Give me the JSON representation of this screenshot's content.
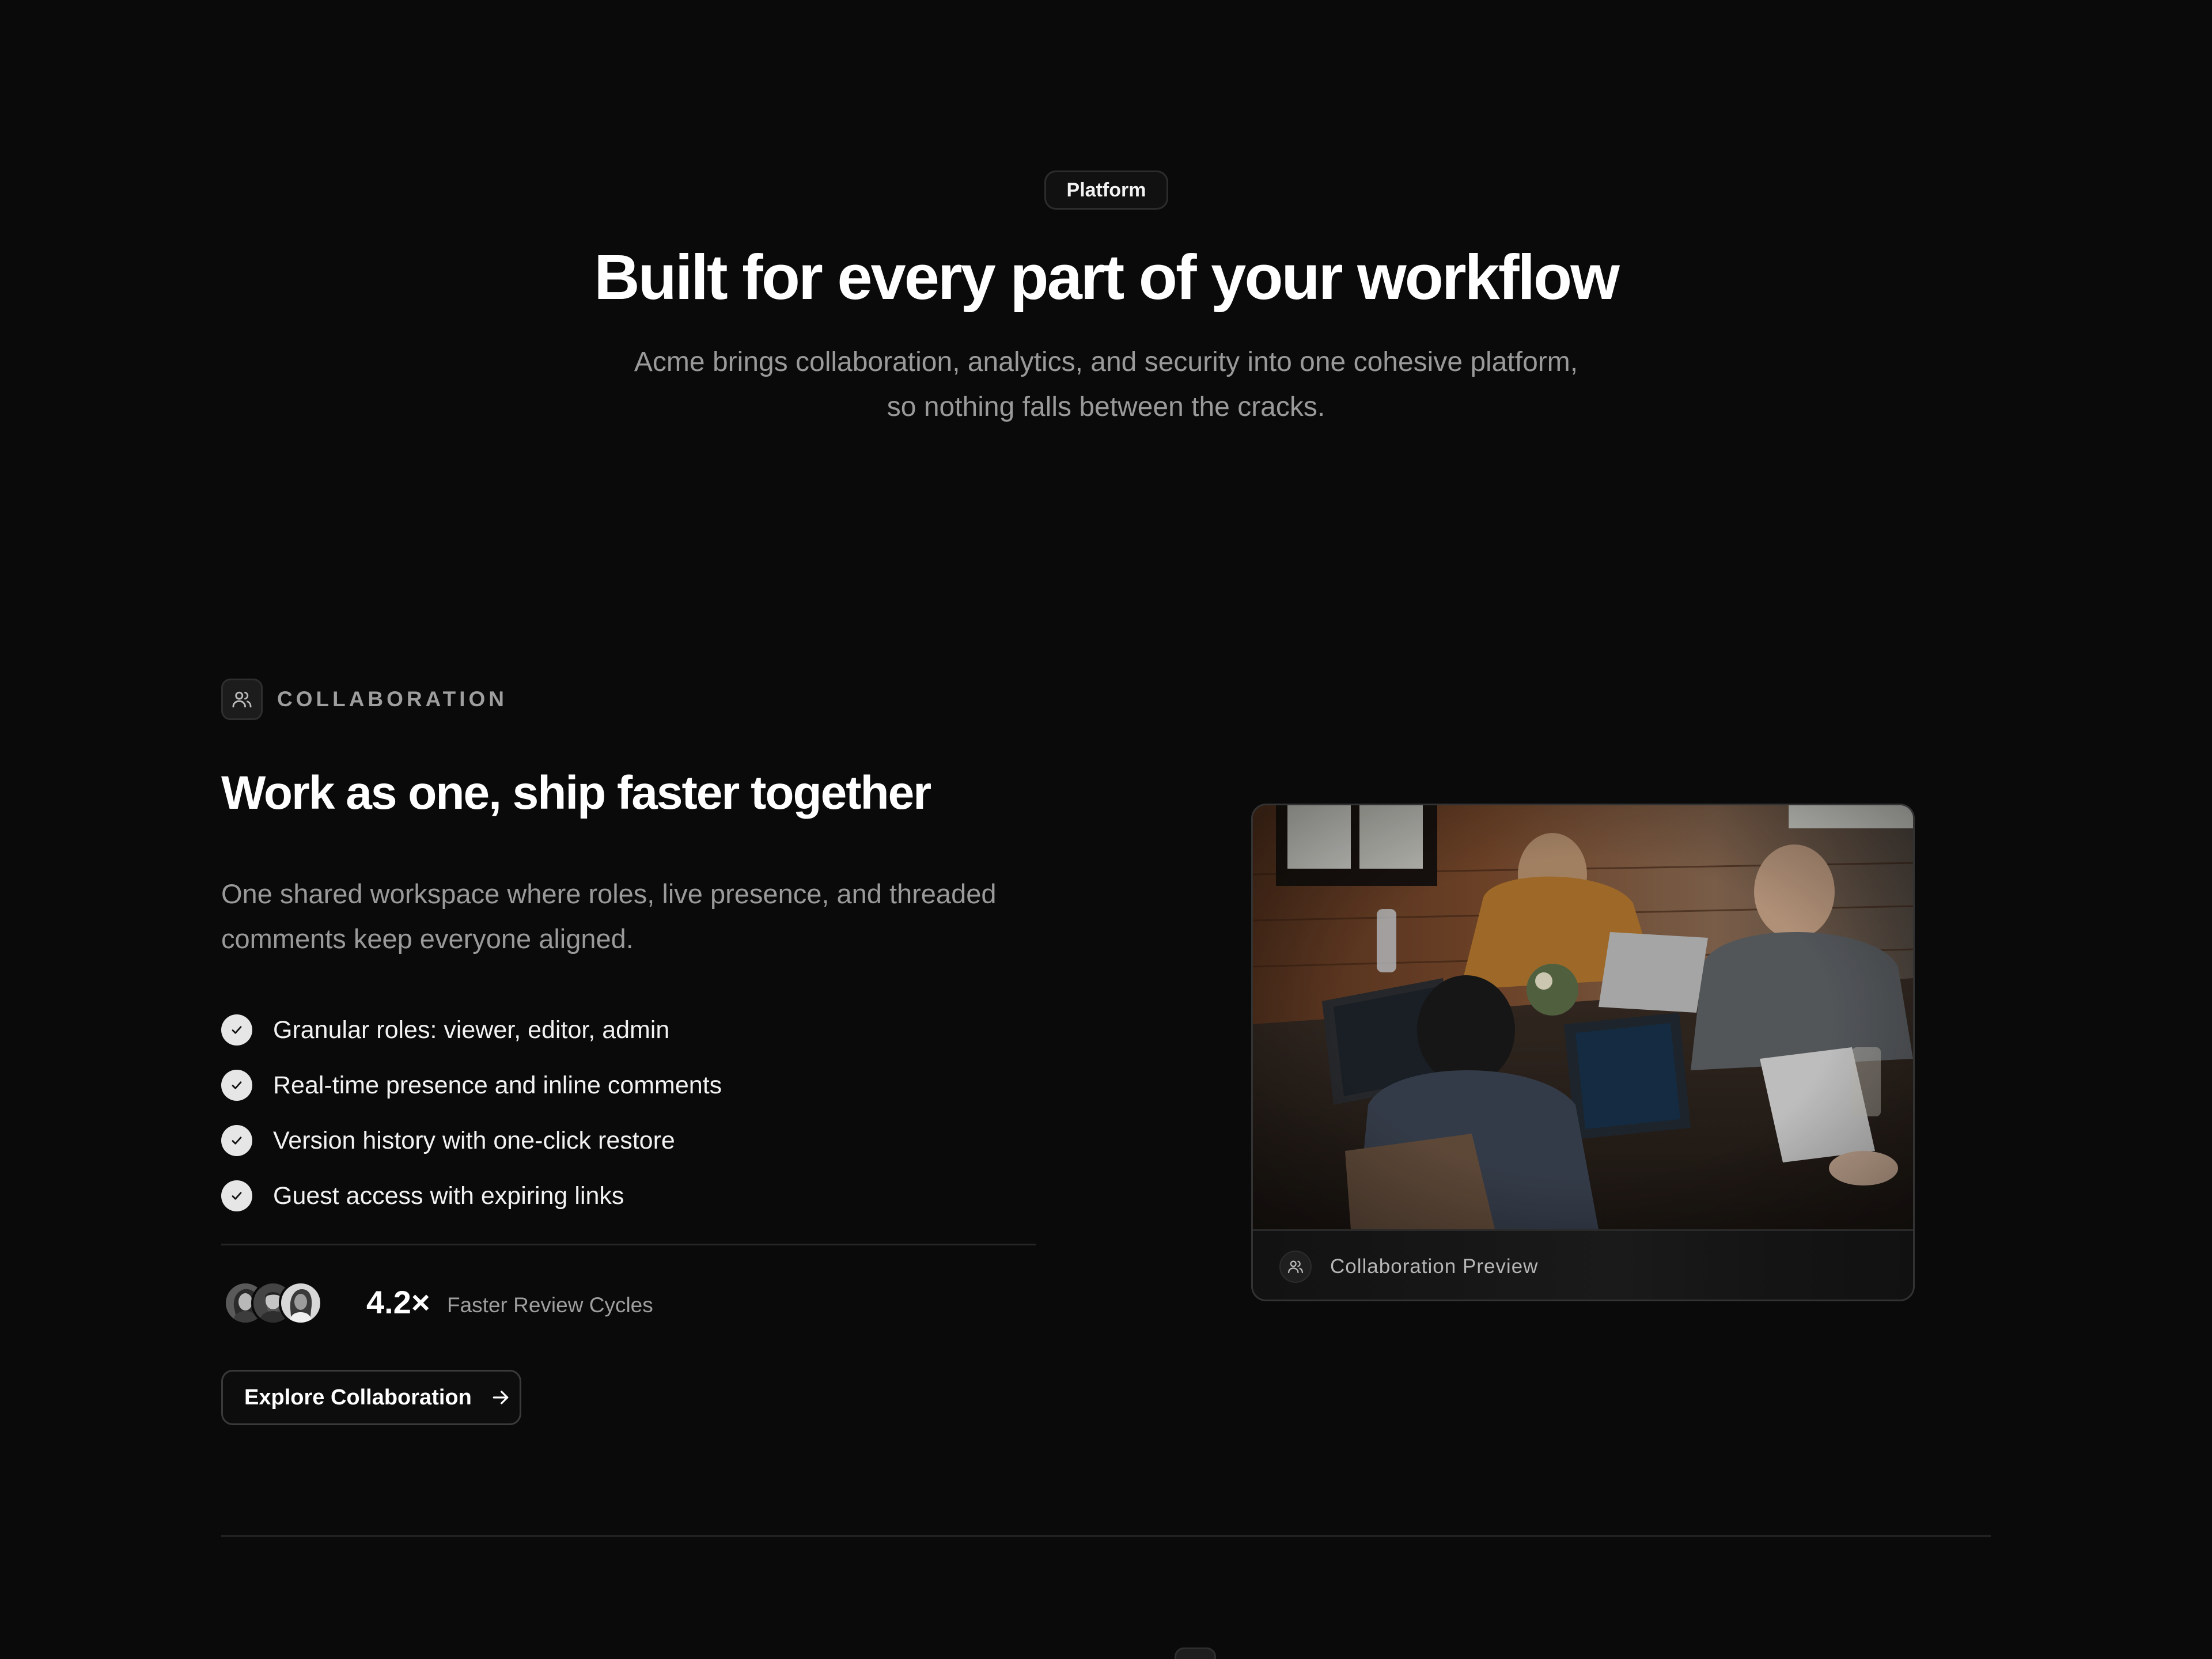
{
  "hero": {
    "badge": "Platform",
    "title": "Built for every part of your workflow",
    "subtitle_line1": "Acme brings collaboration, analytics, and security into one cohesive platform,",
    "subtitle_line2": "so nothing falls between the cracks."
  },
  "feature": {
    "icon": "users-icon",
    "eyebrow": "COLLABORATION",
    "title": "Work as one, ship faster together",
    "description_line1": "One shared workspace where roles, live presence, and threaded",
    "description_line2": "comments keep everyone aligned.",
    "checklist": [
      "Granular roles: viewer, editor, admin",
      "Real-time presence and inline comments",
      "Version history with one-click restore",
      "Guest access with expiring links"
    ],
    "stat": {
      "value": "4.2×",
      "label": "Faster Review Cycles"
    },
    "cta_label": "Explore Collaboration"
  },
  "preview": {
    "footer_icon": "users-icon",
    "footer_label": "Collaboration Preview"
  },
  "colors": {
    "background": "#0a0a0a",
    "text_primary": "#ffffff",
    "text_muted": "#9a9a9a",
    "border": "#2c2c2c"
  }
}
